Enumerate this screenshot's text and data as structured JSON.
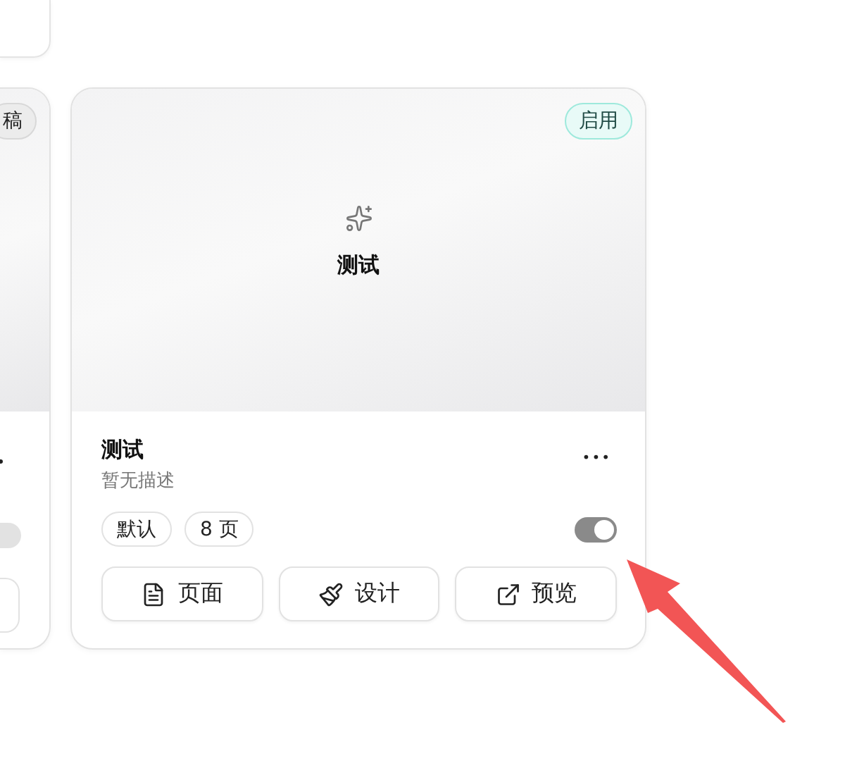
{
  "cards": [
    {
      "status": {
        "label": "稿",
        "kind": "draft"
      },
      "enabled": false
    },
    {
      "status": {
        "label": "启用",
        "kind": "active"
      },
      "preview_title": "测试",
      "title": "测试",
      "description": "暂无描述",
      "menu": "•••",
      "tags": [
        "默认",
        "8 页"
      ],
      "enabled": true,
      "actions": [
        {
          "label": "页面",
          "kind": "pages"
        },
        {
          "label": "设计",
          "kind": "design"
        },
        {
          "label": "预览",
          "kind": "preview"
        }
      ]
    }
  ]
}
